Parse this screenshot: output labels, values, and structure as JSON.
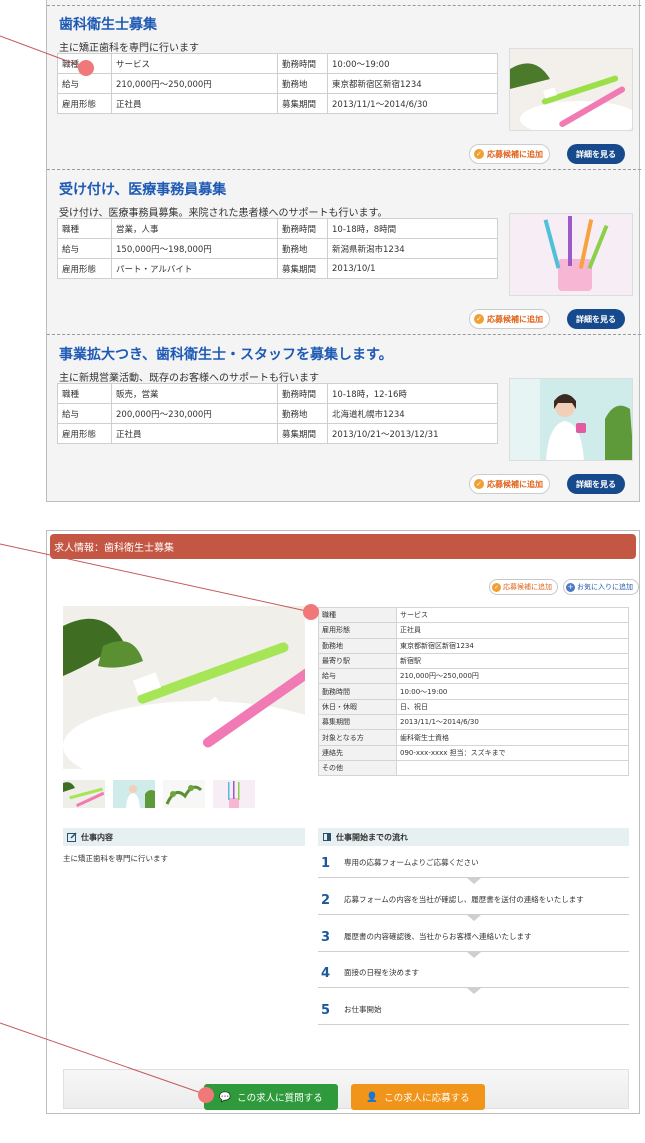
{
  "listing": {
    "jobs": [
      {
        "title": "歯科衛生士募集",
        "description": "主に矯正歯科を専門に行います",
        "rows": [
          {
            "label1": "職種",
            "value1": "サービス",
            "label2": "勤務時間",
            "value2": "10:00〜19:00"
          },
          {
            "label1": "給与",
            "value1": "210,000円〜250,000円",
            "label2": "勤務地",
            "value2": "東京都新宿区新宿1234"
          },
          {
            "label1": "雇用形態",
            "value1": "正社員",
            "label2": "募集期間",
            "value2": "2013/11/1〜2014/6/30"
          }
        ],
        "candidate_label": "応募候補に追加",
        "detail_label": "詳細を見る"
      },
      {
        "title": "受け付け、医療事務員募集",
        "description": "受け付け、医療事務員募集。来院された患者様へのサポートも行います。",
        "rows": [
          {
            "label1": "職種",
            "value1": "営業，人事",
            "label2": "勤務時間",
            "value2": "10-18時，8時間"
          },
          {
            "label1": "給与",
            "value1": "150,000円〜198,000円",
            "label2": "勤務地",
            "value2": "新潟県新潟市1234"
          },
          {
            "label1": "雇用形態",
            "value1": "パート・アルバイト",
            "label2": "募集期間",
            "value2": "2013/10/1"
          }
        ],
        "candidate_label": "応募候補に追加",
        "detail_label": "詳細を見る"
      },
      {
        "title": "事業拡大つき、歯科衛生士・スタッフを募集します。",
        "description": "主に新規営業活動、既存のお客様へのサポートも行います",
        "rows": [
          {
            "label1": "職種",
            "value1": "販売，営業",
            "label2": "勤務時間",
            "value2": "10-18時，12-16時"
          },
          {
            "label1": "給与",
            "value1": "200,000円〜230,000円",
            "label2": "勤務地",
            "value2": "北海道札幌市1234"
          },
          {
            "label1": "雇用形態",
            "value1": "正社員",
            "label2": "募集期間",
            "value2": "2013/10/21〜2013/12/31"
          }
        ],
        "candidate_label": "応募候補に追加",
        "detail_label": "詳細を見る"
      }
    ]
  },
  "detail": {
    "header": "求人情報：歯科衛生士募集",
    "candidate_label": "応募候補に追加",
    "favorite_label": "お気に入りに追加",
    "info": [
      {
        "key": "職種",
        "value": "サービス"
      },
      {
        "key": "雇用形態",
        "value": "正社員"
      },
      {
        "key": "勤務地",
        "value": "東京都新宿区新宿1234"
      },
      {
        "key": "最寄り駅",
        "value": "新宿駅"
      },
      {
        "key": "給与",
        "value": "210,000円〜250,000円"
      },
      {
        "key": "勤務時間",
        "value": "10:00〜19:00"
      },
      {
        "key": "休日・休暇",
        "value": "日、祝日"
      },
      {
        "key": "募集期間",
        "value": "2013/11/1〜2014/6/30"
      },
      {
        "key": "対象となる方",
        "value": "歯科衛生士資格"
      },
      {
        "key": "連絡先",
        "value": "090-xxx-xxxx 担当：スズキまで"
      },
      {
        "key": "その他",
        "value": ""
      }
    ],
    "work_heading": "仕事内容",
    "work_text": "主に矯正歯科を専門に行います",
    "flow_heading": "仕事開始までの流れ",
    "steps": [
      {
        "num": "1",
        "text": "専用の応募フォームよりご応募ください"
      },
      {
        "num": "2",
        "text": "応募フォームの内容を当社が確認し、履歴書を送付の連絡をいたします"
      },
      {
        "num": "3",
        "text": "履歴書の内容確認後、当社からお客様へ連絡いたします"
      },
      {
        "num": "4",
        "text": "面接の日程を決めます"
      },
      {
        "num": "5",
        "text": "お仕事開始"
      }
    ],
    "ask_label": "この求人に質問する",
    "apply_label": "この求人に応募する"
  },
  "colors": {
    "title_blue": "#1e5ab4",
    "header_red": "#c45644",
    "ask_green": "#2f9a3c",
    "apply_orange": "#f0941a",
    "annotation": "#f07878"
  }
}
